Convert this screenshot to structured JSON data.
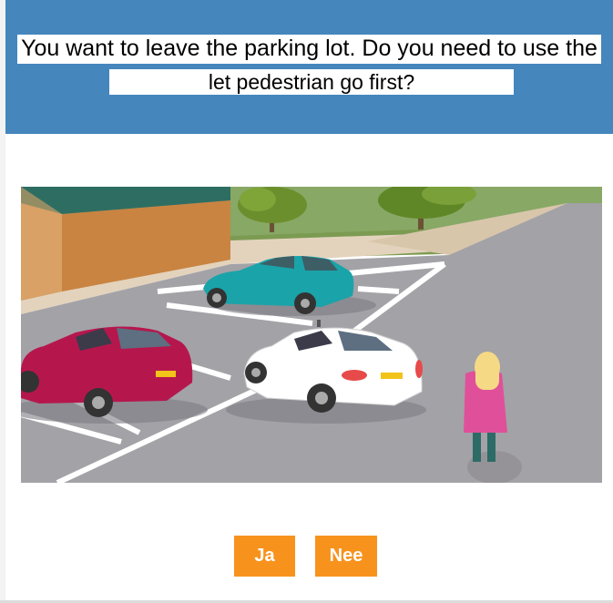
{
  "question": {
    "line1": "You want to leave the parking lot. Do you need to use the",
    "line2": "let pedestrian go first?"
  },
  "scene": {
    "description_icon": "parking-lot-scene",
    "colors": {
      "header_bg": "#4586bd",
      "button_bg": "#f7931d",
      "red_car": "#b5174d",
      "teal_car": "#1aa3a9",
      "white_car": "#ffffff",
      "pedestrian_coat": "#e0509a"
    }
  },
  "answers": {
    "yes_label": "Ja",
    "no_label": "Nee"
  }
}
